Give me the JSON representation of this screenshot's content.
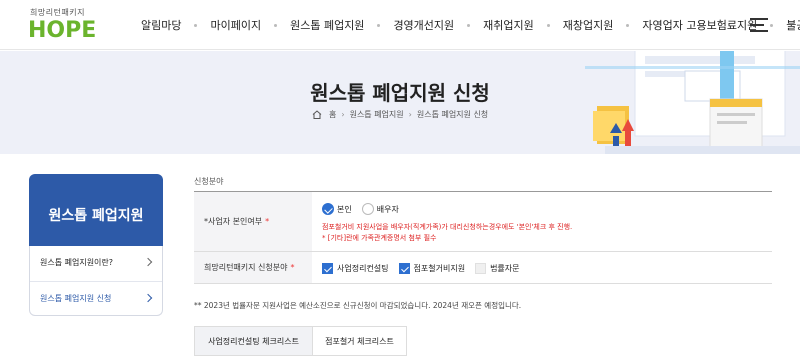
{
  "header": {
    "logo_sub": "희망리턴패키지",
    "logo_main": "HOPE",
    "nav": [
      "알림마당",
      "마이페이지",
      "원스톱 폐업지원",
      "경영개선지원",
      "재취업지원",
      "재창업지원",
      "자영업자 고용보험료지원",
      "불공정신고"
    ]
  },
  "banner": {
    "title": "원스톱 폐업지원 신청",
    "breadcrumb": [
      "홈",
      "원스톱 폐업지원",
      "원스톱 폐업지원 신청"
    ]
  },
  "sidebar": {
    "title": "원스톱 폐업지원",
    "items": [
      {
        "label": "원스톱 폐업지원이란?"
      },
      {
        "label": "원스톱 폐업지원 신청"
      }
    ]
  },
  "form": {
    "section_label": "신청분야",
    "row1": {
      "label": "*사업자 본인여부",
      "req": "*",
      "options": [
        "본인",
        "배우자"
      ],
      "selected": "본인",
      "note1": "점포철거비 지원사업을 배우자(직계가족)가 대리신청하는경우에도 '본인'체크 후 진행.",
      "note2": "* [기타]란에 가족관계증명서 첨부 필수"
    },
    "row2": {
      "label": "희망리턴패키지 신청분야",
      "req": "*",
      "options": [
        "사업정리컨설팅",
        "점포철거비지원",
        "법률자문"
      ]
    },
    "footnote": "** 2023년 법률자문 지원사업은 예산소진으로 신규신청이 마감되었습니다. 2024년 재오픈 예정입니다."
  },
  "tabs": [
    "사업정리컨설팅 체크리스트",
    "점포철거 체크리스트"
  ],
  "colors": {
    "brand_green": "#6bb42d",
    "primary_blue": "#2d5aa8",
    "check_blue": "#2d6fd0",
    "note_red": "#dd2222"
  }
}
